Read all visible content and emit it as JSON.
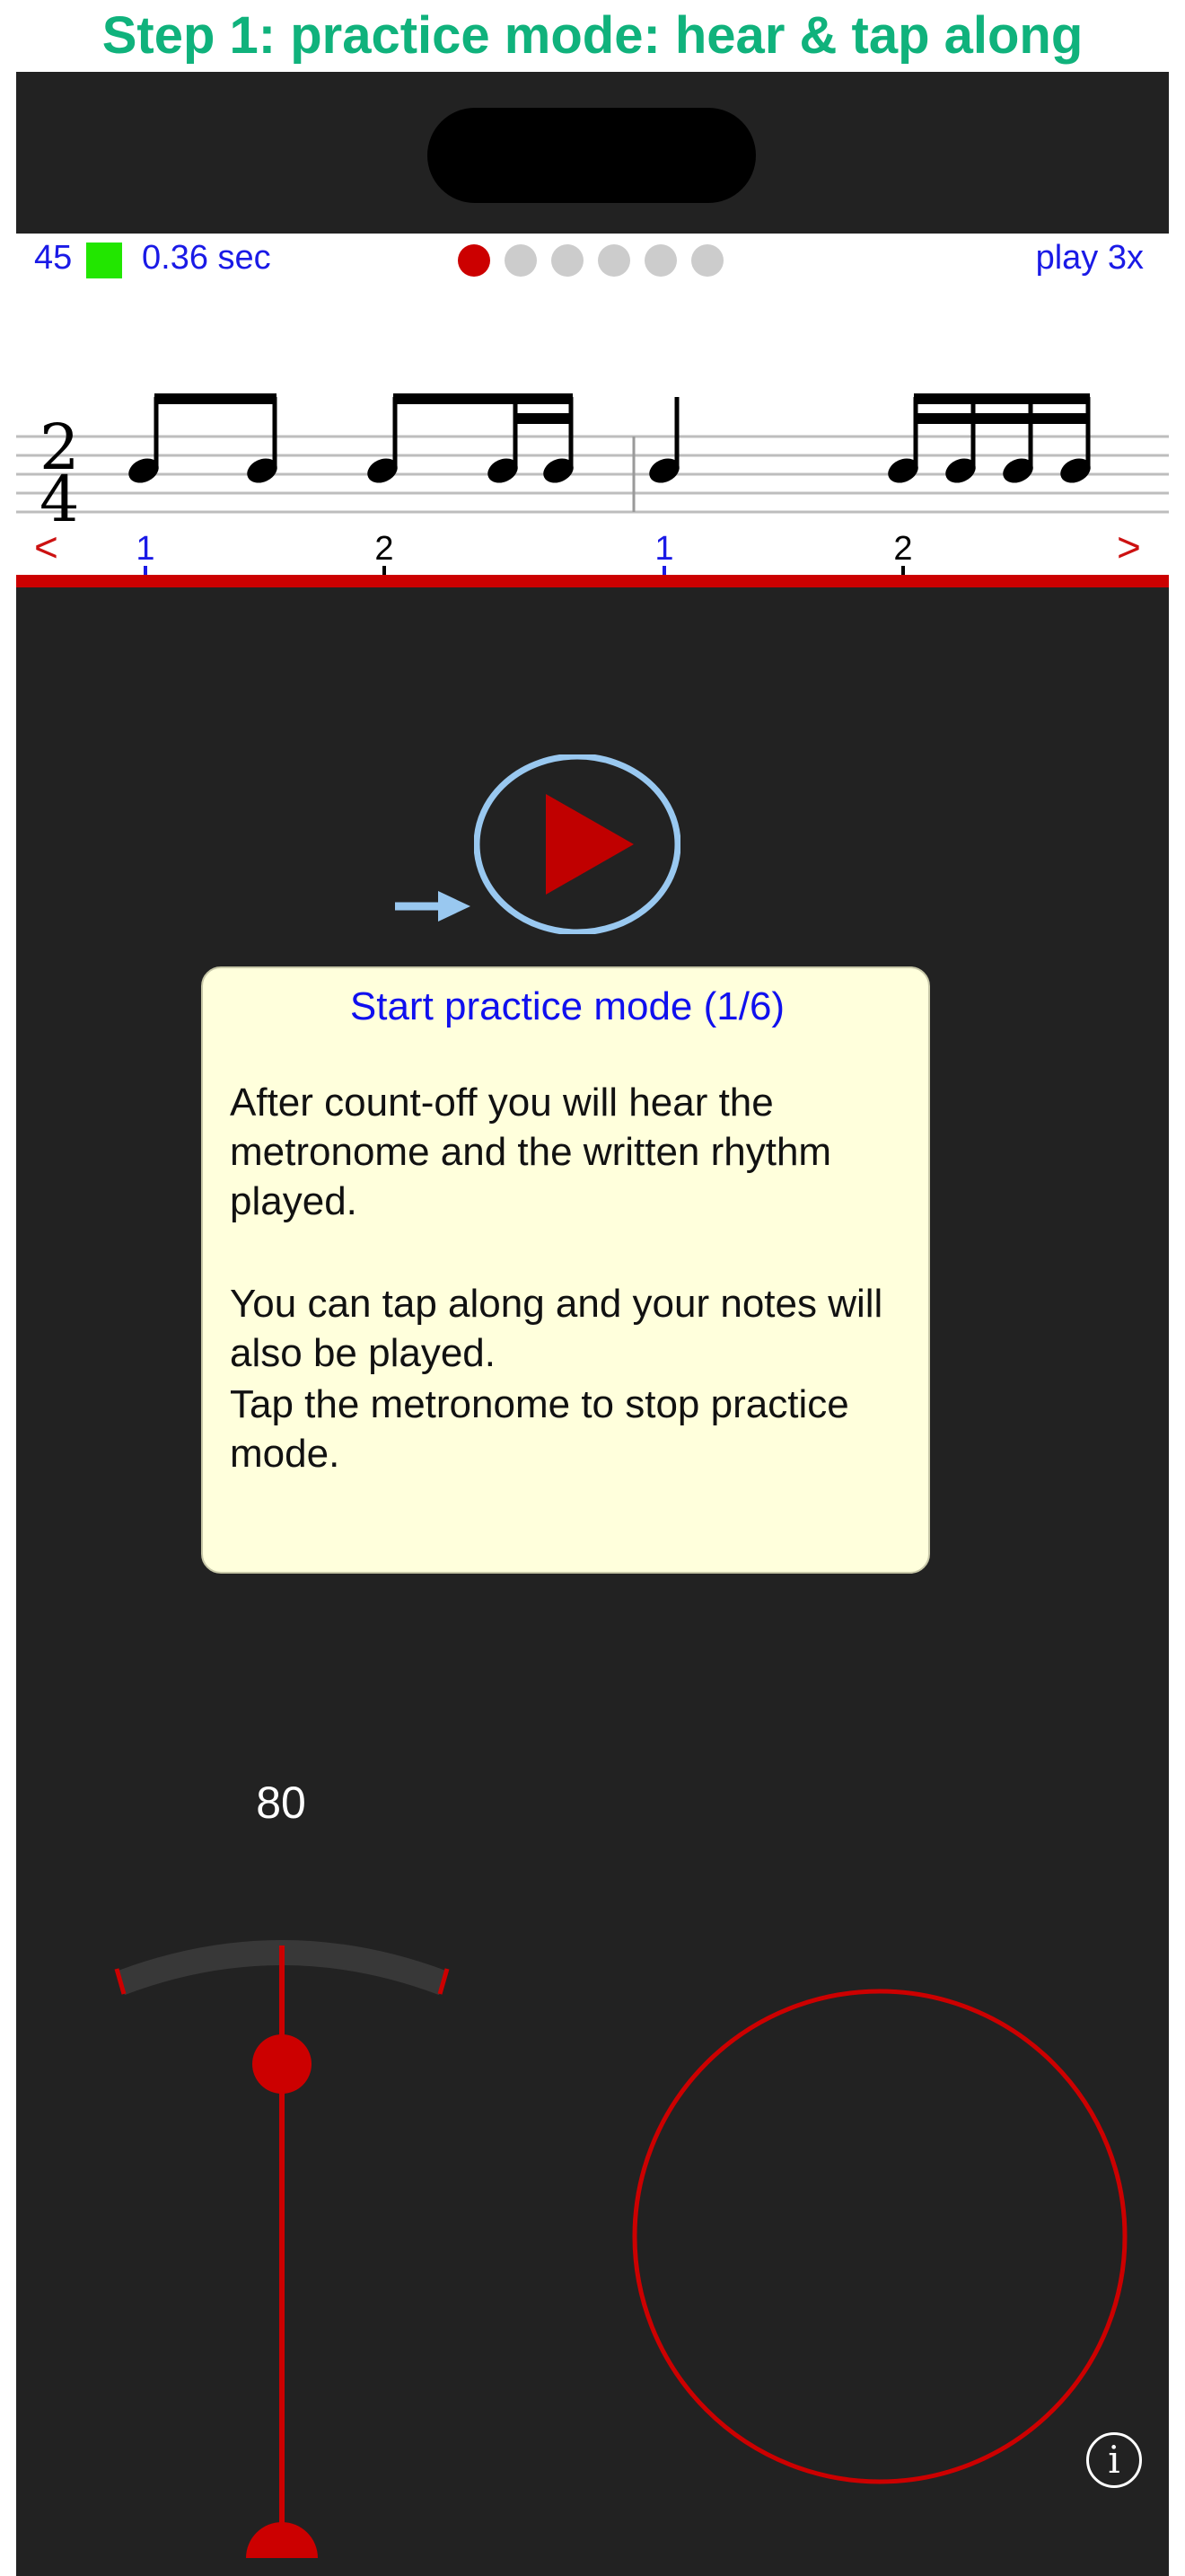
{
  "headline": "Step 1: practice mode: hear & tap along",
  "status_bar": {
    "tempo_value": "45",
    "time_value": "0.36 sec",
    "play_label": "play 3x",
    "progress": {
      "total": 6,
      "current": 1
    }
  },
  "colors": {
    "accent_green": "#10b27c",
    "accent_red": "#cc0000",
    "link_blue": "#1a1ae6",
    "play_circle": "#99c8f0",
    "tooltip_bg": "#ffffdc",
    "indicator_green": "#22e600"
  },
  "score": {
    "time_signature_top": "2",
    "time_signature_bottom": "4"
  },
  "beat_ruler": {
    "prev_label": "<",
    "next_label": ">",
    "beats": [
      "1",
      "2",
      "1",
      "2"
    ]
  },
  "tooltip": {
    "title": "Start practice mode (1/6)",
    "paragraph1": "After count-off you will hear the\nmetronome and the written rhythm\nplayed.",
    "paragraph2": "You can tap along and your notes will\nalso be played.",
    "paragraph3": "Tap the metronome to stop practice\nmode."
  },
  "metronome": {
    "bpm": "80"
  },
  "icons": {
    "play": "play-icon",
    "arrow": "pointer-arrow-icon",
    "info": "info-icon",
    "tap_pad": "tap-circle-icon"
  },
  "info_label": "i"
}
